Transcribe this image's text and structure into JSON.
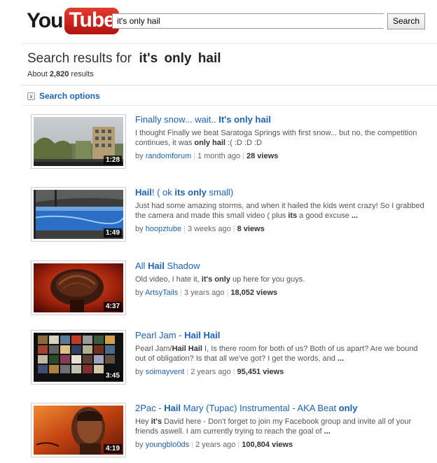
{
  "header": {
    "logo_you": "You",
    "logo_tube": "Tube",
    "search_value": "it's only hail",
    "search_button": "Search"
  },
  "results_header": {
    "prefix": "Search results for",
    "query": "it's only hail",
    "count_prefix": "About",
    "count": "2,820",
    "count_suffix": "results"
  },
  "search_options": {
    "label": "Search options"
  },
  "results": [
    {
      "title_parts": [
        {
          "text": "Finally snow... wait.. ",
          "bold": false
        },
        {
          "text": "It's only hail",
          "bold": true
        }
      ],
      "desc_parts": [
        {
          "text": "I thought Finally we beat Saratoga Springs with first snow... but no, the competition continues, it was ",
          "bold": false
        },
        {
          "text": "only hail",
          "bold": true
        },
        {
          "text": " :( :D :D :D",
          "bold": false
        }
      ],
      "uploader": "randomforum",
      "age": "1 month ago",
      "views": "28 views",
      "duration": "1:28"
    },
    {
      "title_parts": [
        {
          "text": "Hail",
          "bold": true
        },
        {
          "text": "! ( ok ",
          "bold": false
        },
        {
          "text": "its only",
          "bold": true
        },
        {
          "text": " small)",
          "bold": false
        }
      ],
      "desc_parts": [
        {
          "text": "Just had some amazing storms, and when it hailed the kids went crazy! So I grabbed the camera and made this small video ( plus ",
          "bold": false
        },
        {
          "text": "its",
          "bold": true
        },
        {
          "text": " a good excuse ",
          "bold": false
        },
        {
          "text": "...",
          "bold": true
        }
      ],
      "uploader": "hoopztube",
      "age": "3 weeks ago",
      "views": "8 views",
      "duration": "1:49"
    },
    {
      "title_parts": [
        {
          "text": "All ",
          "bold": false
        },
        {
          "text": "Hail",
          "bold": true
        },
        {
          "text": " Shadow",
          "bold": false
        }
      ],
      "desc_parts": [
        {
          "text": "Old video, I hate it, ",
          "bold": false
        },
        {
          "text": "it's only",
          "bold": true
        },
        {
          "text": " up here for you guys.",
          "bold": false
        }
      ],
      "uploader": "ArtsyTails",
      "age": "3 years ago",
      "views": "18,052 views",
      "duration": "4:37"
    },
    {
      "title_parts": [
        {
          "text": "Pearl Jam - ",
          "bold": false
        },
        {
          "text": "Hail Hail",
          "bold": true
        }
      ],
      "desc_parts": [
        {
          "text": "Pearl Jam/",
          "bold": false
        },
        {
          "text": "Hail Hail",
          "bold": true
        },
        {
          "text": " I, Is there room for both of us? Both of us apart? Are we bound out of obligation? Is that all we've got? I get the words, and ",
          "bold": false
        },
        {
          "text": "...",
          "bold": true
        }
      ],
      "uploader": "soimayvent",
      "age": "2 years ago",
      "views": "95,451 views",
      "duration": "3:45"
    },
    {
      "title_parts": [
        {
          "text": "2Pac - ",
          "bold": false
        },
        {
          "text": "Hail",
          "bold": true
        },
        {
          "text": " Mary (Tupac) Instrumental - AKA Beat ",
          "bold": false
        },
        {
          "text": "only",
          "bold": true
        }
      ],
      "desc_parts": [
        {
          "text": "Hey ",
          "bold": false
        },
        {
          "text": "it's",
          "bold": true
        },
        {
          "text": " David here - Don't forget to join my Facebook group and invite all of your friends aswell. I am currently trying to reach the goal of ",
          "bold": false
        },
        {
          "text": "...",
          "bold": true
        }
      ],
      "uploader": "youngblo0ds",
      "age": "2 years ago",
      "views": "100,804 views",
      "duration": "4:19"
    }
  ],
  "labels": {
    "by": "by"
  },
  "colors": {
    "link": "#1c62b9",
    "logo_red": "#cc181e"
  }
}
